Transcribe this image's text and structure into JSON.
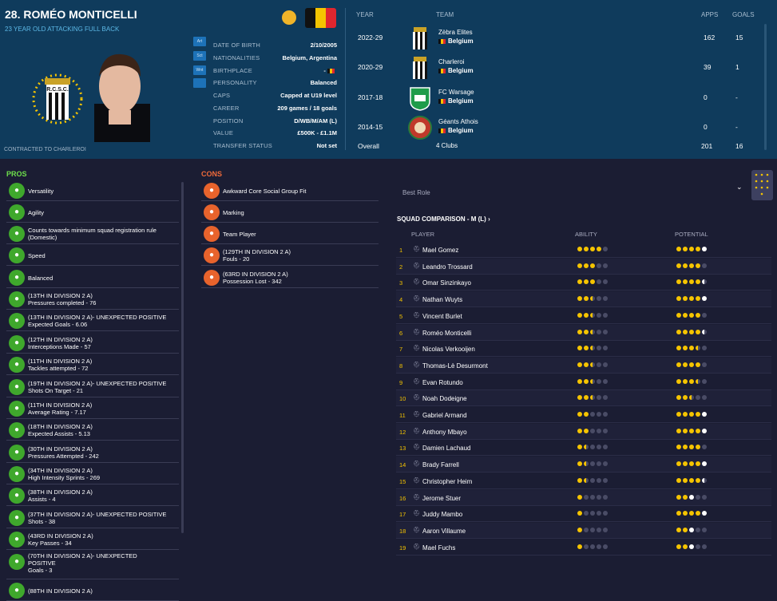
{
  "player": {
    "title": "28. ROMÉO MONTICELLI",
    "subtitle": "23 YEAR OLD ATTACKING FULL BACK",
    "contract": "CONTRACTED TO CHARLEROI",
    "flag_colors": [
      "#111111",
      "#f5c400",
      "#e0262f"
    ]
  },
  "position_pills": [
    "Art",
    "Sct",
    "Wnt",
    ""
  ],
  "info": [
    {
      "label": "DATE OF BIRTH",
      "value": "2/10/2005"
    },
    {
      "label": "NATIONALITIES",
      "value": "Belgium, Argentina"
    },
    {
      "label": "BIRTHPLACE",
      "value": "-"
    },
    {
      "label": "PERSONALITY",
      "value": "Balanced"
    },
    {
      "label": "CAPS",
      "value": "Capped at U19 level"
    },
    {
      "label": "CAREER",
      "value": "209 games /   18 goals"
    },
    {
      "label": "POSITION",
      "value": "D/WB/M/AM (L)"
    },
    {
      "label": "VALUE",
      "value": "£500K - £1.1M"
    },
    {
      "label": "TRANSFER STATUS",
      "value": "Not set"
    }
  ],
  "career": {
    "headers": {
      "year": "YEAR",
      "team": "TEAM",
      "apps": "APPS",
      "goals": "GOALS"
    },
    "rows": [
      {
        "year": "2022-29",
        "club": "Zèbra Elites",
        "nation": "Belgium",
        "apps": "162",
        "goals": "15",
        "badge": "stripes"
      },
      {
        "year": "2020-29",
        "club": "Charleroi",
        "nation": "Belgium",
        "apps": "39",
        "goals": "1",
        "badge": "stripes"
      },
      {
        "year": "2017-18",
        "club": "FC Warsage",
        "nation": "Belgium",
        "apps": "0",
        "goals": "-",
        "badge": "green"
      },
      {
        "year": "2014-15",
        "club": "Géants Athois",
        "nation": "Belgium",
        "apps": "0",
        "goals": "-",
        "badge": "red"
      }
    ],
    "total": {
      "label": "Overall",
      "clubs": "4 Clubs",
      "apps": "201",
      "goals": "16"
    }
  },
  "pros": {
    "title": "PROS",
    "items": [
      {
        "l1": "Versatility",
        "l2": ""
      },
      {
        "l1": "Agility",
        "l2": ""
      },
      {
        "l1": "Counts towards minimum squad registration rule",
        "l2": "(Domestic)"
      },
      {
        "l1": "Speed",
        "l2": ""
      },
      {
        "l1": "Balanced",
        "l2": ""
      },
      {
        "l1": "(13TH IN DIVISION 2 A)",
        "l2": "Pressures completed - 76"
      },
      {
        "l1": "(13TH IN DIVISION 2 A)- UNEXPECTED POSITIVE",
        "l2": "Expected Goals - 6.06"
      },
      {
        "l1": "(12TH IN DIVISION 2 A)",
        "l2": "Interceptions Made - 57"
      },
      {
        "l1": "(11TH IN DIVISION 2 A)",
        "l2": "Tackles attempted - 72"
      },
      {
        "l1": "(19TH IN DIVISION 2 A)- UNEXPECTED POSITIVE",
        "l2": "Shots On Target - 21"
      },
      {
        "l1": "(11TH IN DIVISION 2 A)",
        "l2": "Average Rating - 7.17"
      },
      {
        "l1": "(18TH IN DIVISION 2 A)",
        "l2": "Expected Assists - 5.13"
      },
      {
        "l1": "(30TH IN DIVISION 2 A)",
        "l2": "Pressures Attempted - 242"
      },
      {
        "l1": "(34TH IN DIVISION 2 A)",
        "l2": "High Intensity Sprints - 269"
      },
      {
        "l1": "(38TH IN DIVISION 2 A)",
        "l2": "Assists - 4"
      },
      {
        "l1": "(37TH IN DIVISION 2 A)- UNEXPECTED POSITIVE",
        "l2": "Shots - 38"
      },
      {
        "l1": "(43RD IN DIVISION 2 A)",
        "l2": "Key Passes - 34"
      },
      {
        "l1": "(70TH IN DIVISION 2 A)- UNEXPECTED",
        "l2": "POSITIVE",
        "l3": "Goals - 3"
      },
      {
        "l1": "(88TH IN DIVISION 2 A)",
        "l2": ""
      }
    ]
  },
  "cons": {
    "title": "CONS",
    "items": [
      {
        "l1": "Awkward Core Social Group Fit",
        "l2": ""
      },
      {
        "l1": "Marking",
        "l2": ""
      },
      {
        "l1": "Team Player",
        "l2": ""
      },
      {
        "l1": "(129TH IN DIVISION 2 A)",
        "l2": "Fouls - 20"
      },
      {
        "l1": "(63RD IN DIVISION 2 A)",
        "l2": "Possession Lost - 342"
      }
    ]
  },
  "squad": {
    "best_role": "Best Role",
    "title": "SQUAD COMPARISON - M (L) ›",
    "headers": {
      "player": "PLAYER",
      "ability": "ABILITY",
      "potential": "POTENTIAL"
    },
    "rows": [
      {
        "n": "1",
        "name": "Mael Gomez",
        "ability": 4.0,
        "potential": 5.0,
        "pot_white": true
      },
      {
        "n": "2",
        "name": "Leandro Trossard",
        "ability": 3.0,
        "potential": 4.0
      },
      {
        "n": "3",
        "name": "Omar Sinzinkayo",
        "ability": 3.0,
        "potential": 4.5,
        "pot_white": true
      },
      {
        "n": "4",
        "name": "Nathan Wuyts",
        "ability": 2.5,
        "potential": 5.0,
        "pot_white": true
      },
      {
        "n": "5",
        "name": "Vincent Burlet",
        "ability": 2.5,
        "potential": 4.0
      },
      {
        "n": "6",
        "name": "Roméo Monticelli",
        "ability": 2.5,
        "potential": 4.5,
        "pot_white": true
      },
      {
        "n": "7",
        "name": "Nicolas Verkooijen",
        "ability": 2.5,
        "potential": 3.5
      },
      {
        "n": "8",
        "name": "Thomas-Lè Desurmont",
        "ability": 2.5,
        "potential": 4.0
      },
      {
        "n": "9",
        "name": "Evan Rotundo",
        "ability": 2.5,
        "potential": 3.5
      },
      {
        "n": "10",
        "name": "Noah Dodeigne",
        "ability": 2.5,
        "potential": 2.5
      },
      {
        "n": "11",
        "name": "Gabriel Armand",
        "ability": 2.0,
        "potential": 5.0,
        "pot_white": true
      },
      {
        "n": "12",
        "name": "Anthony Mbayo",
        "ability": 2.0,
        "potential": 5.0,
        "pot_white": true
      },
      {
        "n": "13",
        "name": "Damien Lachaud",
        "ability": 1.5,
        "potential": 4.0
      },
      {
        "n": "14",
        "name": "Brady Farrell",
        "ability": 1.5,
        "potential": 5.0,
        "pot_white": true
      },
      {
        "n": "15",
        "name": "Christopher Heim",
        "ability": 1.5,
        "potential": 4.5,
        "pot_white": true
      },
      {
        "n": "16",
        "name": "Jerome Stuer",
        "ability": 1.0,
        "potential": 3.0,
        "pot_white": true
      },
      {
        "n": "17",
        "name": "Juddy Mambo",
        "ability": 1.0,
        "potential": 5.0,
        "pot_white": true
      },
      {
        "n": "18",
        "name": "Aaron Villaume",
        "ability": 1.0,
        "potential": 3.0,
        "pot_white": true
      },
      {
        "n": "19",
        "name": "Mael Fuchs",
        "ability": 1.0,
        "potential": 3.0,
        "pot_white": true
      }
    ]
  }
}
